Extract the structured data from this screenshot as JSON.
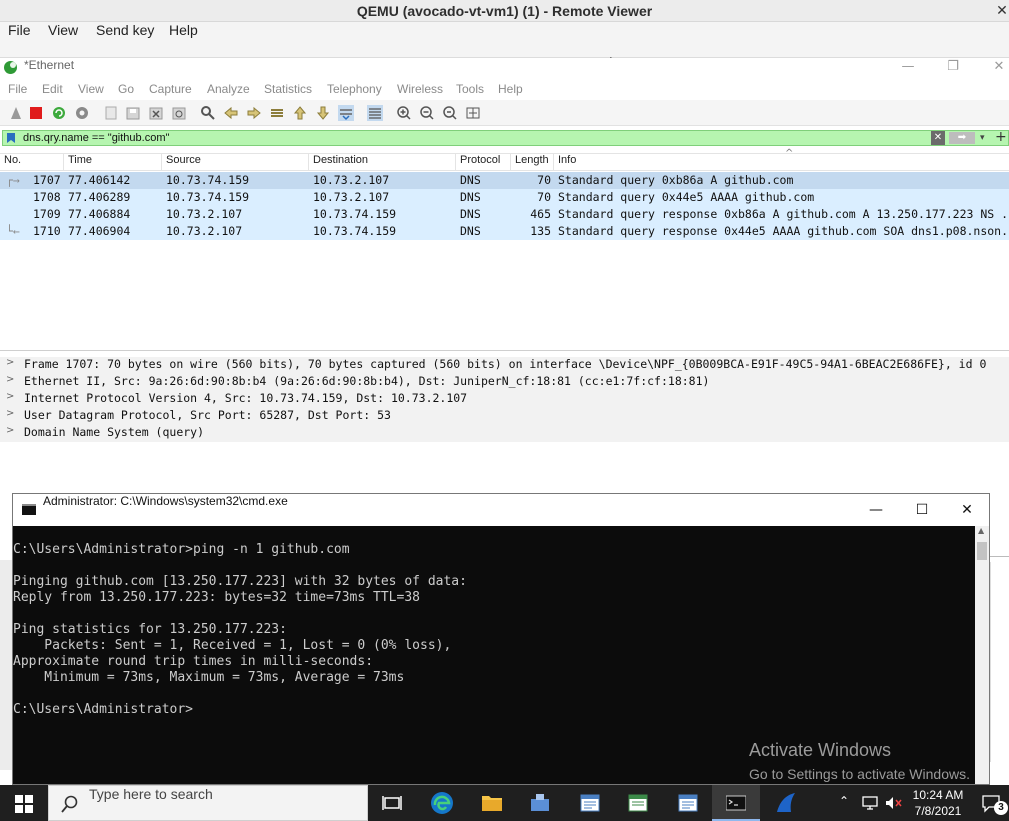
{
  "remote_viewer": {
    "title": "QEMU (avocado-vt-vm1) (1) - Remote Viewer",
    "close": "✕",
    "menu": [
      "File",
      "View",
      "Send key",
      "Help"
    ]
  },
  "wireshark": {
    "title": "*Ethernet",
    "menu": [
      "File",
      "Edit",
      "View",
      "Go",
      "Capture",
      "Analyze",
      "Statistics",
      "Telephony",
      "Wireless",
      "Tools",
      "Help"
    ],
    "filter": "dns.qry.name == \"github.com\"",
    "columns": [
      "No.",
      "Time",
      "Source",
      "Destination",
      "Protocol",
      "Length",
      "Info"
    ],
    "packets": [
      {
        "no": "1707",
        "time": "77.406142",
        "src": "10.73.74.159",
        "dst": "10.73.2.107",
        "proto": "DNS",
        "len": "70",
        "info": "Standard query 0xb86a A github.com"
      },
      {
        "no": "1708",
        "time": "77.406289",
        "src": "10.73.74.159",
        "dst": "10.73.2.107",
        "proto": "DNS",
        "len": "70",
        "info": "Standard query 0x44e5 AAAA github.com"
      },
      {
        "no": "1709",
        "time": "77.406884",
        "src": "10.73.2.107",
        "dst": "10.73.74.159",
        "proto": "DNS",
        "len": "465",
        "info": "Standard query response 0xb86a A github.com A 13.250.177.223 NS ..."
      },
      {
        "no": "1710",
        "time": "77.406904",
        "src": "10.73.2.107",
        "dst": "10.73.74.159",
        "proto": "DNS",
        "len": "135",
        "info": "Standard query response 0x44e5 AAAA github.com SOA dns1.p08.nson..."
      }
    ],
    "details": [
      "Frame 1707: 70 bytes on wire (560 bits), 70 bytes captured (560 bits) on interface \\Device\\NPF_{0B009BCA-E91F-49C5-94A1-6BEAC2E686FE}, id 0",
      "Ethernet II, Src: 9a:26:6d:90:8b:b4 (9a:26:6d:90:8b:b4), Dst: JuniperN_cf:18:81 (cc:e1:7f:cf:18:81)",
      "Internet Protocol Version 4, Src: 10.73.74.159, Dst: 10.73.2.107",
      "User Datagram Protocol, Src Port: 65287, Dst Port: 53",
      "Domain Name System (query)"
    ]
  },
  "cmd": {
    "title": "Administrator: C:\\Windows\\system32\\cmd.exe",
    "lines": [
      "C:\\Users\\Administrator>ping -n 1 github.com",
      "",
      "Pinging github.com [13.250.177.223] with 32 bytes of data:",
      "Reply from 13.250.177.223: bytes=32 time=73ms TTL=38",
      "",
      "Ping statistics for 13.250.177.223:",
      "    Packets: Sent = 1, Received = 1, Lost = 0 (0% loss),",
      "Approximate round trip times in milli-seconds:",
      "    Minimum = 73ms, Maximum = 73ms, Average = 73ms",
      "",
      "C:\\Users\\Administrator>"
    ],
    "activate_title": "Activate Windows",
    "activate_sub": "Go to Settings to activate Windows."
  },
  "taskbar": {
    "search_placeholder": "Type here to search",
    "time": "10:24 AM",
    "date": "7/8/2021",
    "notification_count": "3"
  }
}
